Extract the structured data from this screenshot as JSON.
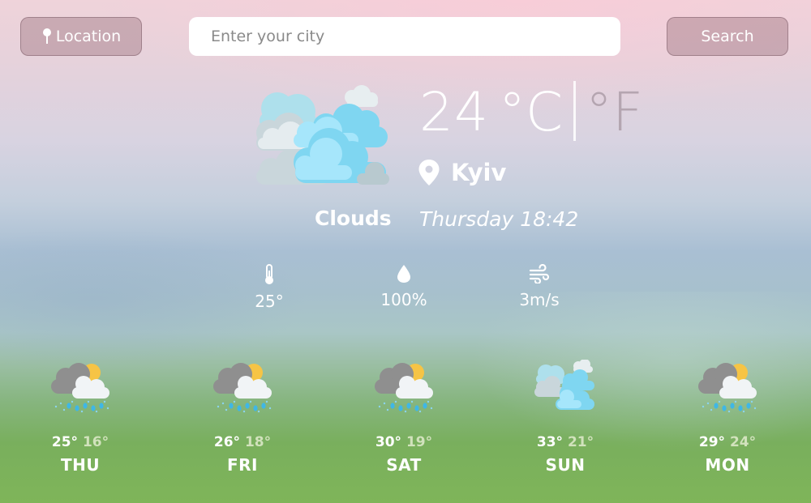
{
  "header": {
    "location_label": "Location",
    "search_placeholder": "Enter your city",
    "search_value": "",
    "search_label": "Search"
  },
  "current": {
    "temperature": "24",
    "unit_c": "°C",
    "unit_f": "°F",
    "city": "Kyiv",
    "condition": "Clouds",
    "datetime": "Thursday 18:42",
    "icon": "clouds-icon"
  },
  "stats": {
    "feels_like": "25°",
    "humidity": "100%",
    "wind": "3m/s"
  },
  "forecast": [
    {
      "day": "THU",
      "high": "25°",
      "low": "16°",
      "icon": "rain-cloud-sun-icon"
    },
    {
      "day": "FRI",
      "high": "26°",
      "low": "18°",
      "icon": "rain-cloud-sun-icon"
    },
    {
      "day": "SAT",
      "high": "30°",
      "low": "19°",
      "icon": "rain-cloud-sun-icon"
    },
    {
      "day": "SUN",
      "high": "33°",
      "low": "21°",
      "icon": "clouds-icon"
    },
    {
      "day": "MON",
      "high": "29°",
      "low": "24°",
      "icon": "rain-cloud-sun-icon"
    }
  ],
  "colors": {
    "button_bg": "#a07882",
    "inactive_unit": "#a596a0",
    "low_temp": "#e1ebcd",
    "cloud_blue": "#7ad6f3",
    "cloud_grey": "#cfd8dc",
    "sun": "#f6c445"
  }
}
